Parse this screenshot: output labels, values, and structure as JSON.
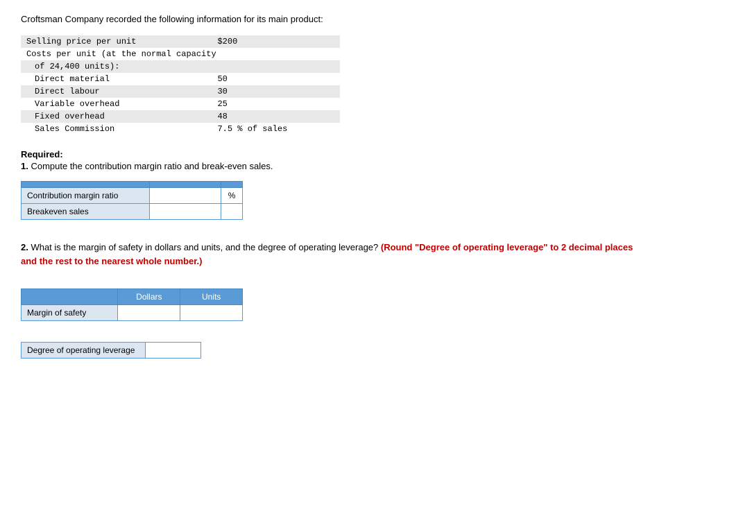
{
  "intro": {
    "text": "Croftsman Company recorded the following information for its main product:"
  },
  "info_table": {
    "rows": [
      {
        "label": "Selling price per unit",
        "value": "$200",
        "indent": 0
      },
      {
        "label": "Costs per unit (at the normal capacity",
        "value": "",
        "indent": 0
      },
      {
        "label": "of 24,400 units):",
        "value": "",
        "indent": 1
      },
      {
        "label": "Direct material",
        "value": "50",
        "indent": 1
      },
      {
        "label": "Direct labour",
        "value": "30",
        "indent": 1
      },
      {
        "label": "Variable overhead",
        "value": "25",
        "indent": 1
      },
      {
        "label": "Fixed overhead",
        "value": "48",
        "indent": 1
      },
      {
        "label": "Sales Commission",
        "value": "7.5 % of sales",
        "indent": 1
      }
    ]
  },
  "required": {
    "label": "Required:",
    "question1": {
      "number": "1.",
      "text": " Compute the contribution margin ratio and break-even sales."
    },
    "question2": {
      "number": "2.",
      "text": " What is the margin of safety in dollars and units, and the degree of operating leverage?",
      "red_text": " (Round \"Degree of operating leverage\" to 2 decimal places and the rest to the nearest whole number.)"
    }
  },
  "table1": {
    "headers": [
      "",
      "",
      "%"
    ],
    "rows": [
      {
        "label": "Contribution margin ratio",
        "input_value": "",
        "show_percent": true
      },
      {
        "label": "Breakeven sales",
        "input_value": "",
        "show_percent": false
      }
    ]
  },
  "table2": {
    "col1_header": "Dollars",
    "col2_header": "Units",
    "rows": [
      {
        "label": "Margin of safety",
        "dollars_value": "",
        "units_value": ""
      }
    ]
  },
  "table3": {
    "rows": [
      {
        "label": "Degree of operating leverage",
        "input_value": ""
      }
    ]
  }
}
